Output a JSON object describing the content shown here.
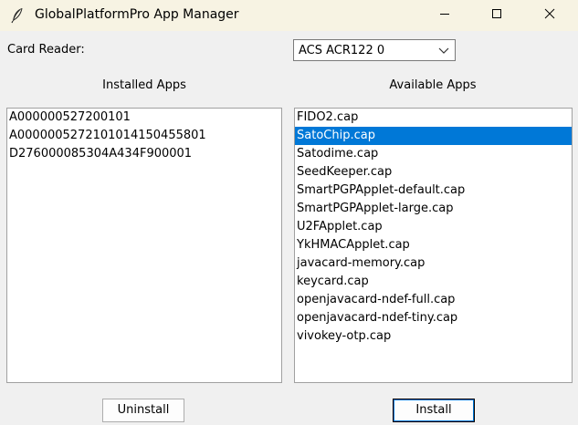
{
  "window": {
    "title": "GlobalPlatformPro App Manager",
    "icons": {
      "app": "feather-icon",
      "minimize": "minimize-icon",
      "maximize": "maximize-icon",
      "close": "close-icon"
    }
  },
  "card_reader": {
    "label": "Card Reader:",
    "selected": "ACS ACR122 0"
  },
  "installed": {
    "heading": "Installed Apps",
    "items": [
      "A000000527200101",
      "A00000052721010141504558 01",
      "D276000085304A434F900001"
    ]
  },
  "available": {
    "heading": "Available Apps",
    "selected_index": 1,
    "items": [
      "FIDO2.cap",
      "SatoChip.cap",
      "Satodime.cap",
      "SeedKeeper.cap",
      "SmartPGPApplet-default.cap",
      "SmartPGPApplet-large.cap",
      "U2FApplet.cap",
      "YkHMACApplet.cap",
      "javacard-memory.cap",
      "keycard.cap",
      "openjavacard-ndef-full.cap",
      "openjavacard-ndef-tiny.cap",
      "vivokey-otp.cap"
    ]
  },
  "buttons": {
    "uninstall": "Uninstall",
    "install": "Install"
  },
  "colors": {
    "selection": "#0078d7",
    "titlebar": "#f7f3e3"
  }
}
